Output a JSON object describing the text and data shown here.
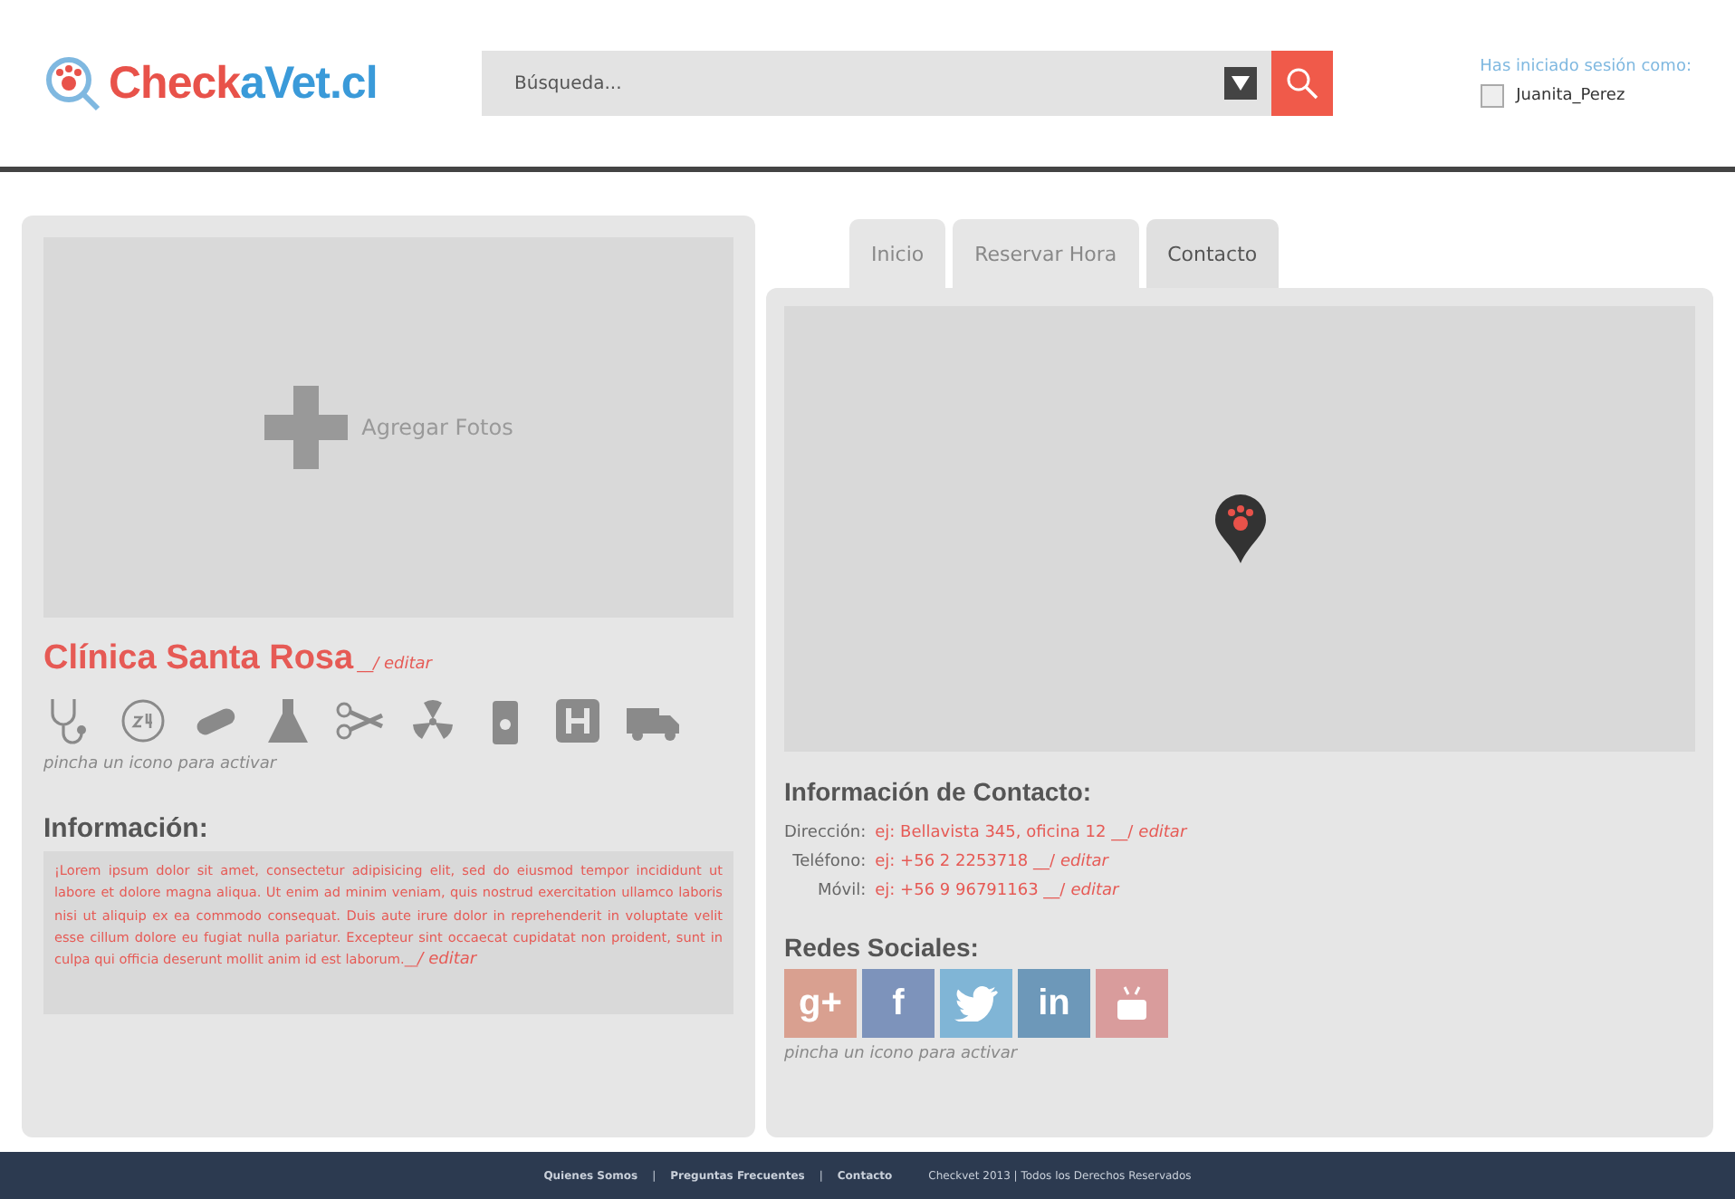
{
  "header": {
    "logo": {
      "prefix": "Check",
      "suffix": "aVet.cl"
    },
    "search": {
      "placeholder": "Búsqueda..."
    },
    "session": {
      "label": "Has iniciado sesión como:",
      "user": "Juanita_Perez"
    }
  },
  "profile": {
    "photo_label": "Agregar Fotos",
    "name": "Clínica Santa Rosa",
    "name_edit": "__/ editar",
    "services": [
      {
        "kind": "stethoscope",
        "active": false
      },
      {
        "kind": "clock",
        "active": false
      },
      {
        "kind": "pill",
        "active": false
      },
      {
        "kind": "flask",
        "active": false
      },
      {
        "kind": "scissors",
        "active": false
      },
      {
        "kind": "radiation",
        "active": false
      },
      {
        "kind": "food",
        "active": false
      },
      {
        "kind": "hospital",
        "active": false
      },
      {
        "kind": "truck",
        "active": false
      }
    ],
    "services_hint": "pincha un icono para activar",
    "info_title": "Información:",
    "info_text": "¡Lorem ipsum dolor sit amet, consectetur adipisicing elit, sed do eiusmod tempor incididunt ut labore et dolore magna aliqua. Ut enim ad minim veniam, quis nostrud exercitation ullamco laboris nisi ut aliquip ex ea commodo consequat. Duis aute irure dolor in reprehenderit in voluptate velit esse cillum dolore eu fugiat nulla pariatur. Excepteur sint occaecat cupidatat non proident, sunt in culpa qui officia deserunt mollit anim id est laborum.__",
    "info_edit": "/ editar"
  },
  "tabs": [
    {
      "label": "Inicio",
      "selected": false
    },
    {
      "label": "Reservar Hora",
      "selected": false
    },
    {
      "label": "Contacto",
      "selected": true
    }
  ],
  "contact": {
    "title": "Información de Contacto:",
    "rows": [
      {
        "label": "Dirección:",
        "value": "ej: Bellavista 345, oficina 12 __/",
        "edit": "editar"
      },
      {
        "label": "Teléfono:",
        "value": "ej: +56 2 2253718 __/",
        "edit": "editar"
      },
      {
        "label": "Móvil:",
        "value": "ej: +56 9 96791163 __/",
        "edit": "editar"
      }
    ],
    "social_title": "Redes Sociales:",
    "social": [
      {
        "kind": "googleplus",
        "label": "g+",
        "color": "#d9a090"
      },
      {
        "kind": "facebook",
        "label": "f",
        "color": "#7d93bb"
      },
      {
        "kind": "twitter",
        "color": "#80b5d6"
      },
      {
        "kind": "linkedin",
        "label": "in",
        "color": "#6d98b9"
      },
      {
        "kind": "youtube",
        "color": "#d99c9c"
      }
    ],
    "social_hint": "pincha un icono para activar"
  },
  "footer": {
    "links": [
      "Quienes Somos",
      "Preguntas Frecuentes",
      "Contacto"
    ],
    "separator": "|",
    "copyright": "Checkvet 2013 | Todos los Derechos Reservados"
  }
}
